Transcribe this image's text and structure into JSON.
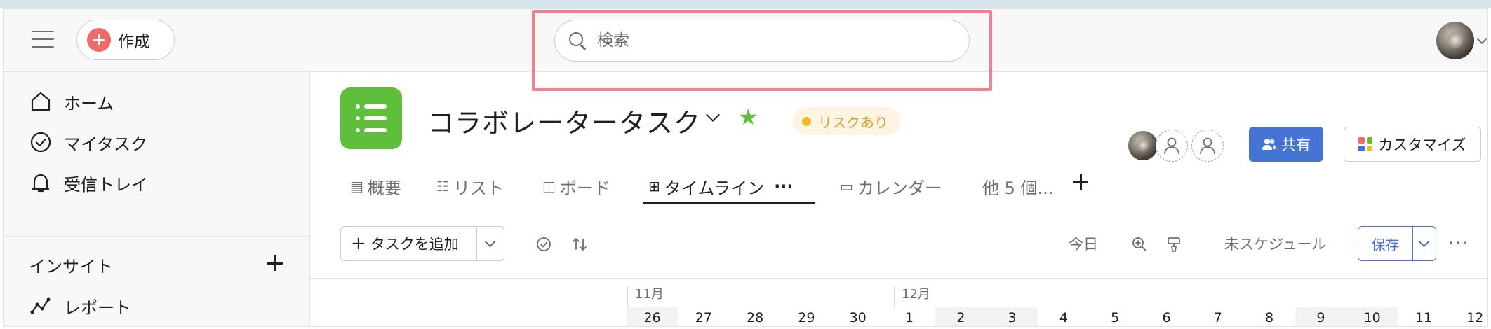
{
  "topbar": {
    "create_label": "作成",
    "search_placeholder": "検索"
  },
  "sidebar": {
    "items": [
      {
        "label": "ホーム",
        "icon": "home-icon"
      },
      {
        "label": "マイタスク",
        "icon": "check-circle-icon"
      },
      {
        "label": "受信トレイ",
        "icon": "bell-icon"
      }
    ],
    "insight_title": "インサイト",
    "insight_items": [
      {
        "label": "レポート",
        "icon": "report-line-icon"
      }
    ]
  },
  "project": {
    "title": "コラボレータータスク",
    "status_label": "リスクあり",
    "share_label": "共有",
    "customize_label": "カスタマイズ"
  },
  "tabs": [
    {
      "label": "概要",
      "icon": "overview-icon"
    },
    {
      "label": "リスト",
      "icon": "list-icon"
    },
    {
      "label": "ボード",
      "icon": "board-icon"
    },
    {
      "label": "タイムライン",
      "icon": "timeline-icon",
      "active": true,
      "more": "···"
    },
    {
      "label": "カレンダー",
      "icon": "calendar-icon"
    },
    {
      "label": "他 5 個...",
      "icon": ""
    }
  ],
  "toolbar": {
    "add_task_label": "タスクを追加",
    "today_label": "今日",
    "unscheduled_label": "未スケジュール",
    "save_label": "保存",
    "more_label": "···"
  },
  "timeline": {
    "months": [
      "11月",
      "12月"
    ],
    "days": [
      "26",
      "27",
      "28",
      "29",
      "30",
      "1",
      "2",
      "3",
      "4",
      "5",
      "6",
      "7",
      "8",
      "9",
      "10",
      "11",
      "12"
    ],
    "weekend_days": [
      "26",
      "2",
      "3",
      "9",
      "10"
    ]
  },
  "colors": {
    "accent_blue": "#4573d2",
    "create_red": "#f06a6a",
    "project_green": "#5fbf3c",
    "risk_yellow": "#f1bd2a",
    "highlight_pink": "#ef8193"
  }
}
